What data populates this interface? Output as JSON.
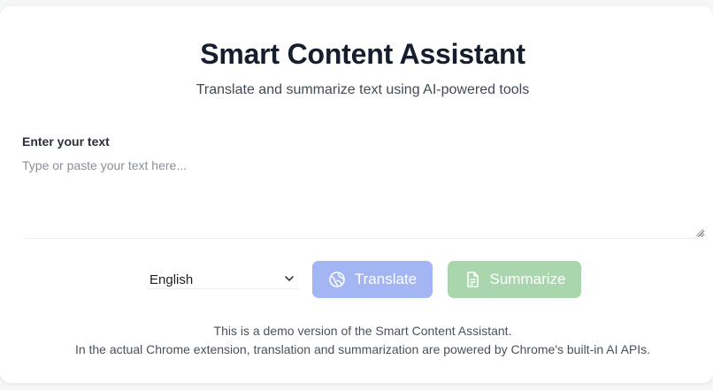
{
  "header": {
    "title": "Smart Content Assistant",
    "subtitle": "Translate and summarize text using AI-powered tools"
  },
  "input": {
    "label": "Enter your text",
    "placeholder": "Type or paste your text here...",
    "value": ""
  },
  "language_select": {
    "selected": "English"
  },
  "actions": {
    "translate_label": "Translate",
    "translate_icon": "globe-icon",
    "summarize_label": "Summarize",
    "summarize_icon": "document-icon"
  },
  "footer": {
    "note_line1": "This is a demo version of the Smart Content Assistant.",
    "note_line2": "In the actual Chrome extension, translation and summarization are powered by Chrome's built-in AI APIs."
  },
  "colors": {
    "translate_button": "#a3b5f2",
    "summarize_button": "#a9d6ad",
    "title_text": "#161d2e"
  }
}
